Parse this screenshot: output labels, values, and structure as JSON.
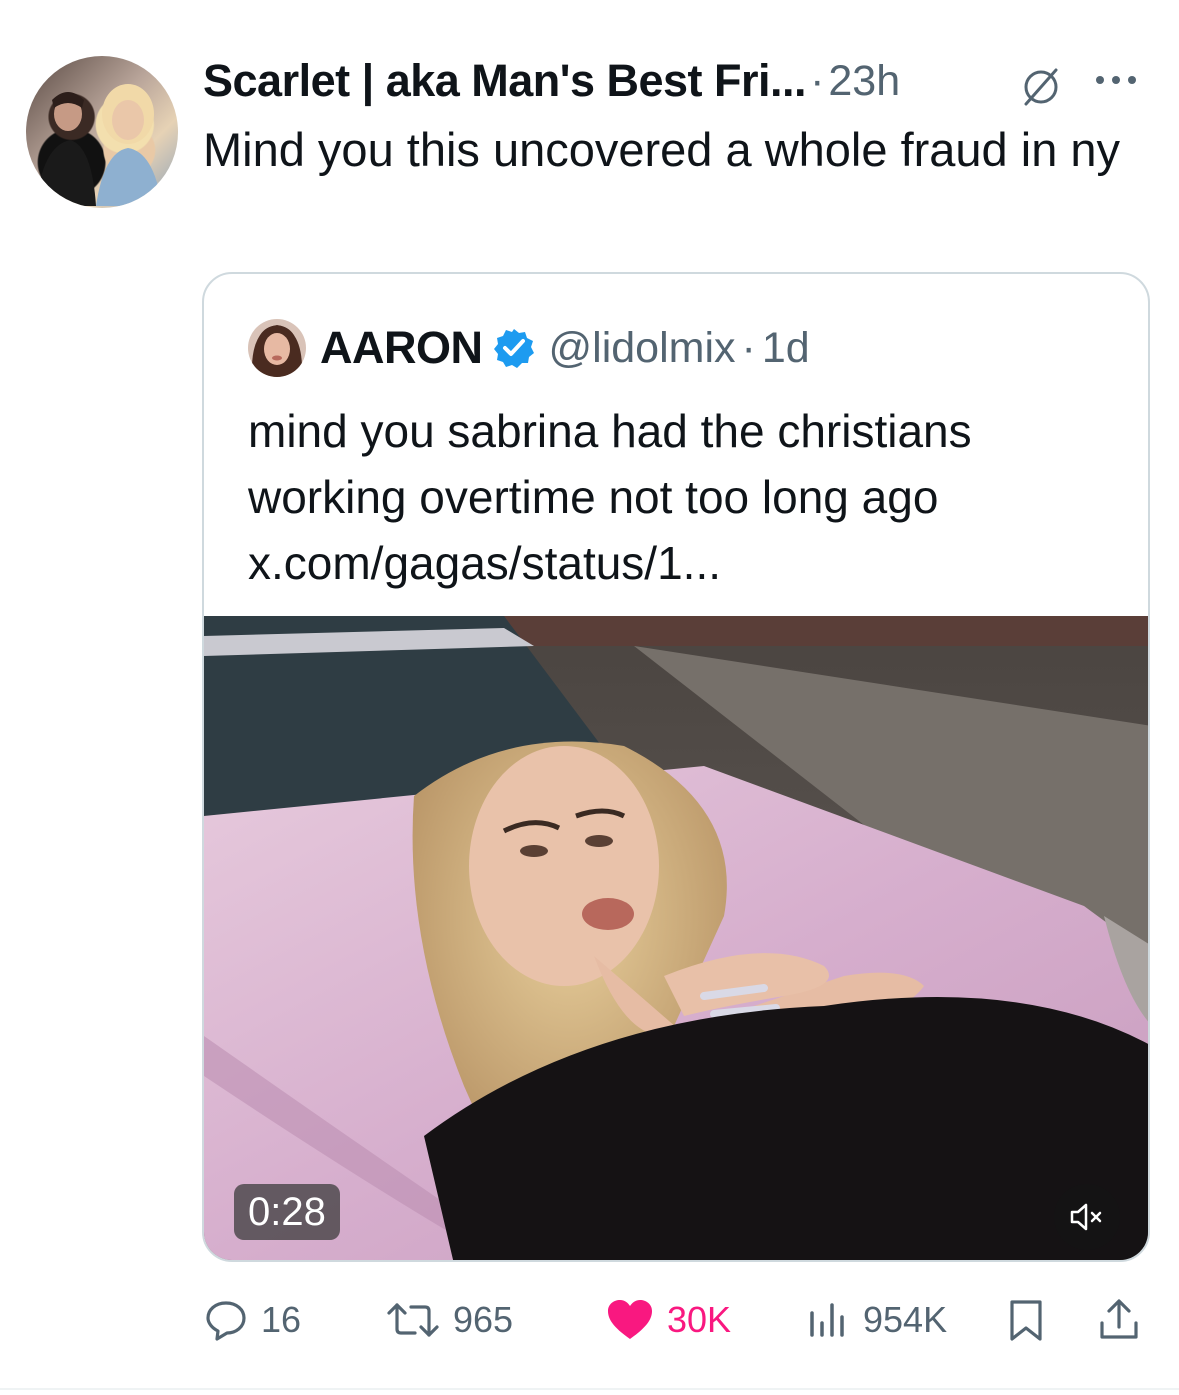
{
  "tweet": {
    "display_name": "Scarlet | aka Man's Best Fri...",
    "separator": "·",
    "timestamp": "23h",
    "text": "Mind you this uncovered a whole fraud in ny"
  },
  "quote": {
    "display_name": "AARON",
    "verified": true,
    "handle": "@lidolmix",
    "separator": "·",
    "timestamp": "1d",
    "text": "mind you sabrina had the christians working overtime not too long ago x.com/gagas/status/1...",
    "video": {
      "duration": "0:28",
      "muted": true
    }
  },
  "actions": {
    "replies": "16",
    "reposts": "965",
    "likes": "30K",
    "views": "954K"
  },
  "colors": {
    "text_primary": "#0f1419",
    "text_secondary": "#536471",
    "verified_blue": "#1d9bf0",
    "like_pink": "#f91880",
    "border": "#cfd9de"
  },
  "icons": {
    "mute": "mute-conversation-icon",
    "more": "more-options-icon",
    "verified": "verified-badge-icon",
    "volume": "volume-muted-icon",
    "reply": "reply-icon",
    "repost": "repost-icon",
    "like": "heart-filled-icon",
    "views": "views-icon",
    "bookmark": "bookmark-icon",
    "share": "share-icon"
  }
}
